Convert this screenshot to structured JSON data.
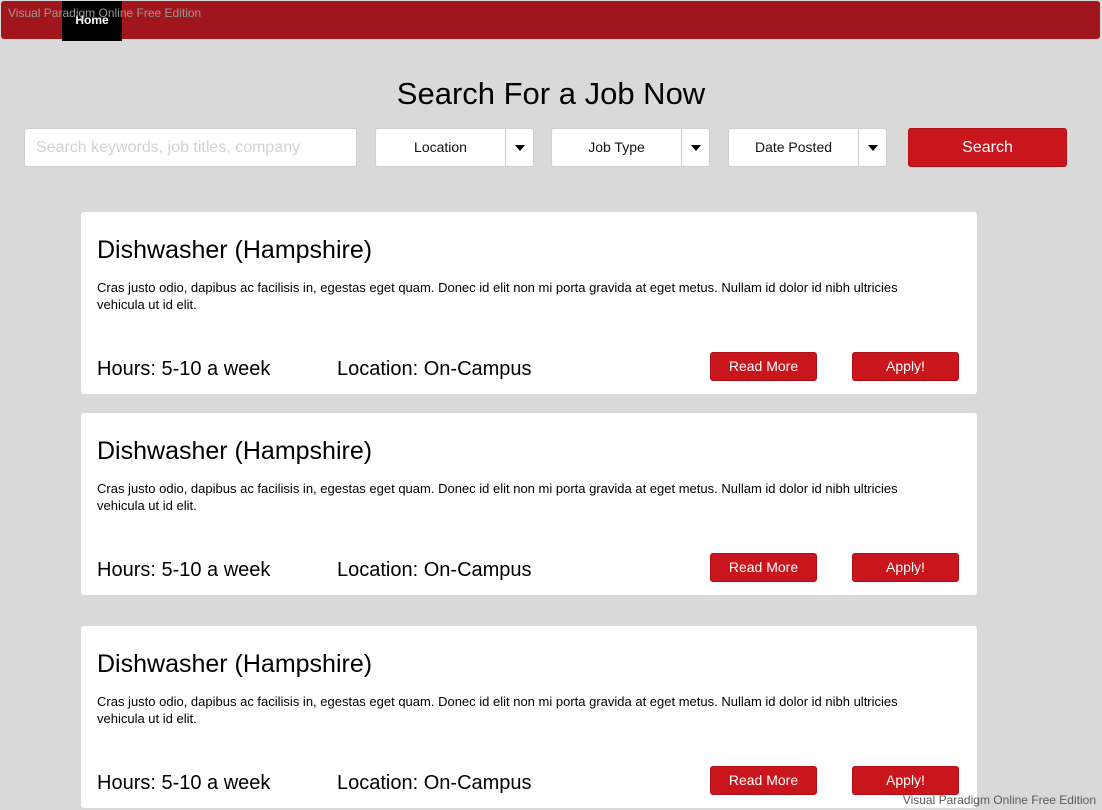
{
  "watermark": "Visual Paradigm Online Free Edition",
  "nav": {
    "home_label": "Home"
  },
  "page_title": "Search For a Job Now",
  "search": {
    "placeholder": "Search keywords, job titles, company",
    "value": "",
    "button_label": "Search"
  },
  "filters": [
    {
      "label": "Location"
    },
    {
      "label": "Job Type"
    },
    {
      "label": "Date Posted"
    }
  ],
  "colors": {
    "brand_red": "#c8161c",
    "topbar_red": "#a0161c",
    "background": "#d9d9d9"
  },
  "jobs": [
    {
      "title": "Dishwasher (Hampshire)",
      "description": "Cras justo odio, dapibus ac facilisis in, egestas eget quam. Donec id elit non mi porta gravida at eget metus. Nullam id dolor id nibh ultricies vehicula ut id elit.",
      "hours": "Hours: 5-10 a week",
      "location": "Location: On-Campus",
      "read_more_label": "Read More",
      "apply_label": "Apply!"
    },
    {
      "title": "Dishwasher (Hampshire)",
      "description": "Cras justo odio, dapibus ac facilisis in, egestas eget quam. Donec id elit non mi porta gravida at eget metus. Nullam id dolor id nibh ultricies vehicula ut id elit.",
      "hours": "Hours: 5-10 a week",
      "location": "Location: On-Campus",
      "read_more_label": "Read More",
      "apply_label": "Apply!"
    },
    {
      "title": "Dishwasher (Hampshire)",
      "description": "Cras justo odio, dapibus ac facilisis in, egestas eget quam. Donec id elit non mi porta gravida at eget metus. Nullam id dolor id nibh ultricies vehicula ut id elit.",
      "hours": "Hours: 5-10 a week",
      "location": "Location: On-Campus",
      "read_more_label": "Read More",
      "apply_label": "Apply!"
    }
  ]
}
